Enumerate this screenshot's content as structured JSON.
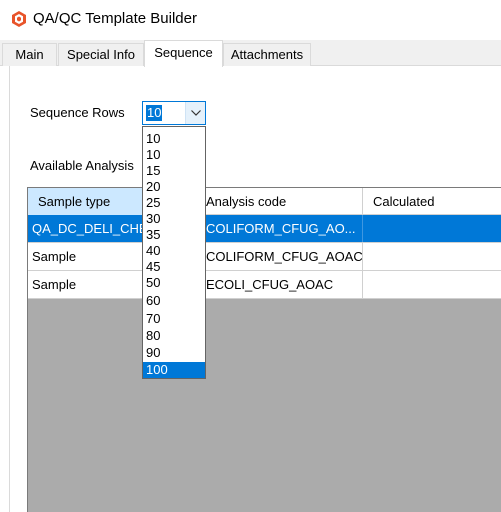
{
  "window": {
    "title": "QA/QC Template Builder",
    "icon": "app-logo-icon"
  },
  "tabs": [
    {
      "label": "Main",
      "active": false
    },
    {
      "label": "Special Info",
      "active": false
    },
    {
      "label": "Sequence",
      "active": true
    },
    {
      "label": "Attachments",
      "active": false
    }
  ],
  "sequence": {
    "rows_label": "Sequence Rows",
    "rows_value": "10",
    "rows_options": [
      "10",
      "10",
      "15",
      "20",
      "25",
      "30",
      "35",
      "40",
      "45",
      "50",
      "60",
      "70",
      "80",
      "90",
      "100"
    ],
    "highlighted_option": "100",
    "available_label": "Available Analysis"
  },
  "grid": {
    "columns": [
      "Sample type",
      "Analysis code",
      "Calculated"
    ],
    "rows": [
      {
        "sample_type": "QA_DC_DELI_CHE",
        "analysis_code": "COLIFORM_CFUG_AO...",
        "calculated": "",
        "selected": true
      },
      {
        "sample_type": "Sample",
        "analysis_code": "COLIFORM_CFUG_AOAC",
        "calculated": "",
        "selected": false
      },
      {
        "sample_type": "Sample",
        "analysis_code": "ECOLI_CFUG_AOAC",
        "calculated": "",
        "selected": false
      }
    ]
  },
  "colors": {
    "accent": "#0078d7",
    "header_selected": "#cce8ff",
    "grid_empty": "#ababab",
    "logo": "#e8542a"
  }
}
